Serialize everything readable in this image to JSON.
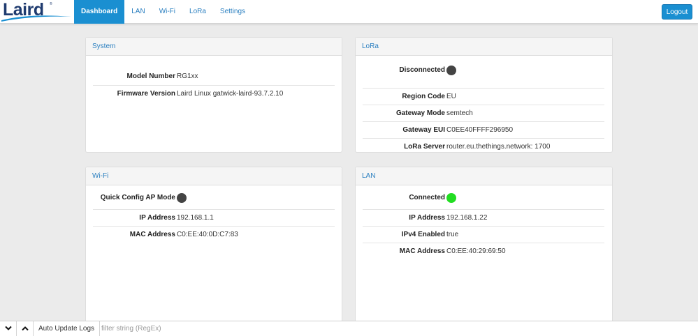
{
  "colors": {
    "brand_blue": "#1a8fd1",
    "logo_navy": "#1f3b6f",
    "nav_text": "#2a7fc0",
    "dot_off": "#444444",
    "dot_on": "#22dd22"
  },
  "header": {
    "logo_text": "Laird",
    "logo_tm": "®",
    "nav": [
      {
        "label": "Dashboard",
        "active": true
      },
      {
        "label": "LAN",
        "active": false
      },
      {
        "label": "Wi-Fi",
        "active": false
      },
      {
        "label": "LoRa",
        "active": false
      },
      {
        "label": "Settings",
        "active": false
      }
    ],
    "logout_label": "Logout"
  },
  "panels": {
    "system": {
      "title": "System",
      "rows": [
        {
          "label": "Model Number",
          "value": "RG1xx"
        },
        {
          "label": "Firmware Version",
          "value": "Laird Linux gatwick-laird-93.7.2.10"
        }
      ]
    },
    "lora": {
      "title": "LoRa",
      "status_label": "Disconnected",
      "status_icon": "status-off",
      "rows": [
        {
          "label": "Region Code",
          "value": "EU"
        },
        {
          "label": "Gateway Mode",
          "value": "semtech"
        },
        {
          "label": "Gateway EUI",
          "value": "C0EE40FFFF296950"
        },
        {
          "label": "LoRa Server",
          "value": "router.eu.thethings.network: 1700"
        }
      ]
    },
    "wifi": {
      "title": "Wi-Fi",
      "status_label": "Quick Config AP Mode",
      "status_icon": "status-off",
      "rows": [
        {
          "label": "IP Address",
          "value": "192.168.1.1"
        },
        {
          "label": "MAC Address",
          "value": "C0:EE:40:0D:C7:83"
        }
      ]
    },
    "lan": {
      "title": "LAN",
      "status_label": "Connected",
      "status_icon": "status-on",
      "rows": [
        {
          "label": "IP Address",
          "value": "192.168.1.22"
        },
        {
          "label": "IPv4 Enabled",
          "value": "true"
        },
        {
          "label": "MAC Address",
          "value": "C0:EE:40:29:69:50"
        }
      ]
    }
  },
  "logbar": {
    "collapse_icon": "chevron-down-icon",
    "expand_icon": "chevron-up-icon",
    "auto_update_label": "Auto Update Logs",
    "filter_placeholder": "filter string (RegEx)",
    "filter_value": ""
  }
}
